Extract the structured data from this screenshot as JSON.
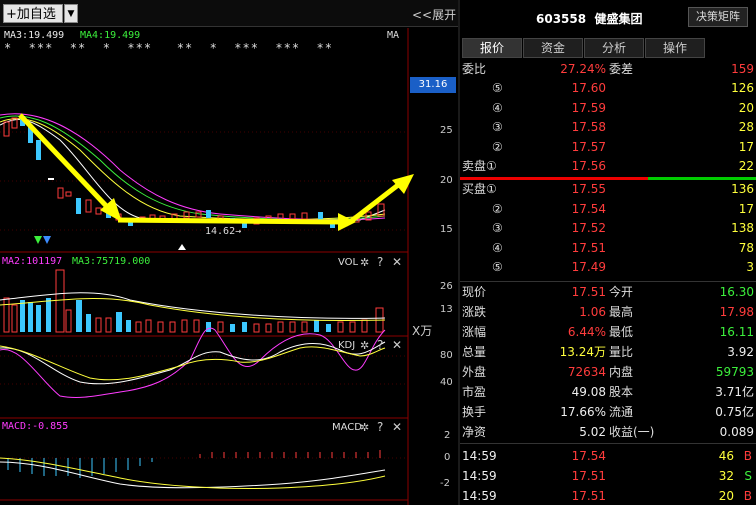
{
  "toolbar": {
    "add_label": "加自选",
    "expand_label": "<<展开",
    "dropdown_glyph": "▼"
  },
  "kline": {
    "ma3": "MA3:19.499",
    "ma4": "MA4:19.499",
    "ma_tag": "MA",
    "stars": "*  ***  **  *  ***   **  *  ***  ***  **",
    "current_price": "31.16",
    "axis": [
      "25",
      "20",
      "15"
    ],
    "low_label": "14.62→"
  },
  "vol": {
    "ma2": "MA2:101197",
    "ma3": "MA3:75719.000",
    "name": "VOL",
    "axis": [
      "26",
      "13"
    ],
    "unit": "X万"
  },
  "kdj": {
    "name": "KDJ",
    "axis": [
      "80",
      "40"
    ]
  },
  "macd": {
    "title": "MACD:-0.855",
    "name": "MACD",
    "axis": [
      "2",
      "0",
      "-2"
    ]
  },
  "quote": {
    "code": "603558",
    "name": "健盛集团",
    "matrix_label": "决策矩阵",
    "tabs": [
      "报价",
      "资金",
      "分析",
      "操作"
    ],
    "wei_bi_label": "委比",
    "wei_bi": "27.24%",
    "wei_cha_label": "委差",
    "wei_cha": "159",
    "sell": [
      {
        "lv": "⑤",
        "price": "17.60",
        "vol": "126"
      },
      {
        "lv": "④",
        "price": "17.59",
        "vol": "20"
      },
      {
        "lv": "③",
        "price": "17.58",
        "vol": "28"
      },
      {
        "lv": "②",
        "price": "17.57",
        "vol": "17"
      },
      {
        "lv": "卖盘①",
        "price": "17.56",
        "vol": "22"
      }
    ],
    "buy": [
      {
        "lv": "买盘①",
        "price": "17.55",
        "vol": "136"
      },
      {
        "lv": "②",
        "price": "17.54",
        "vol": "17"
      },
      {
        "lv": "③",
        "price": "17.52",
        "vol": "138"
      },
      {
        "lv": "④",
        "price": "17.51",
        "vol": "78"
      },
      {
        "lv": "⑤",
        "price": "17.49",
        "vol": "3"
      }
    ],
    "stats": [
      {
        "l1": "现价",
        "v1": "17.51",
        "c1": "red",
        "l2": "今开",
        "v2": "16.30",
        "c2": "grn"
      },
      {
        "l1": "涨跌",
        "v1": "1.06",
        "c1": "red",
        "l2": "最高",
        "v2": "17.98",
        "c2": "red"
      },
      {
        "l1": "涨幅",
        "v1": "6.44%",
        "c1": "red",
        "l2": "最低",
        "v2": "16.11",
        "c2": "grn"
      },
      {
        "l1": "总量",
        "v1": "13.24万",
        "c1": "yel",
        "l2": "量比",
        "v2": "3.92",
        "c2": "wht"
      },
      {
        "l1": "外盘",
        "v1": "72634",
        "c1": "red",
        "l2": "内盘",
        "v2": "59793",
        "c2": "grn"
      },
      {
        "l1": "市盈",
        "v1": "49.08",
        "c1": "wht",
        "l2": "股本",
        "v2": "3.71亿",
        "c2": "wht"
      },
      {
        "l1": "换手",
        "v1": "17.66%",
        "c1": "wht",
        "l2": "流通",
        "v2": "0.75亿",
        "c2": "wht"
      },
      {
        "l1": "净资",
        "v1": "5.02",
        "c1": "wht",
        "l2": "收益(一)",
        "v2": "0.089",
        "c2": "wht"
      }
    ],
    "ticks": [
      {
        "time": "14:59",
        "price": "17.54",
        "vol": "46",
        "side": "B"
      },
      {
        "time": "14:59",
        "price": "17.51",
        "vol": "32",
        "side": "S"
      },
      {
        "time": "14:59",
        "price": "17.51",
        "vol": "20",
        "side": "B"
      }
    ]
  }
}
